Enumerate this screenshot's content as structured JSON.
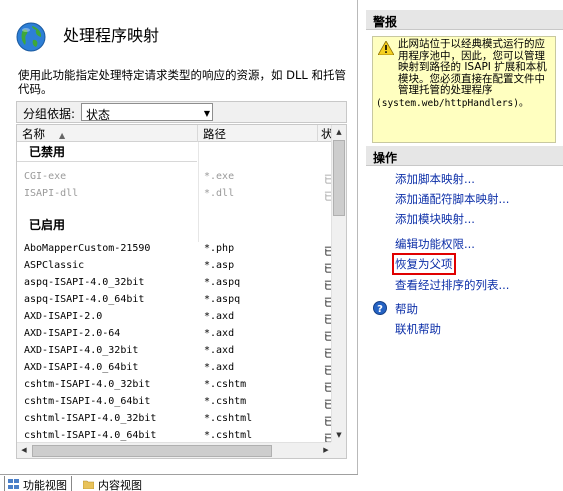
{
  "page": {
    "title": "处理程序映射",
    "description": "使用此功能指定处理特定请求类型的响应的资源，如 DLL 和托管代码。",
    "group_label": "分组依据:",
    "group_value": "状态"
  },
  "list": {
    "columns": [
      "名称",
      "路径",
      "状"
    ],
    "group_disabled": "已禁用",
    "group_enabled": "已启用",
    "disabled_rows": [
      {
        "name": "CGI-exe",
        "path": "*.exe",
        "state": "已"
      },
      {
        "name": "ISAPI-dll",
        "path": "*.dll",
        "state": "已"
      }
    ],
    "enabled_rows": [
      {
        "name": "AboMapperCustom-21590",
        "path": "*.php",
        "state": "已"
      },
      {
        "name": "ASPClassic",
        "path": "*.asp",
        "state": "已"
      },
      {
        "name": "aspq-ISAPI-4.0_32bit",
        "path": "*.aspq",
        "state": "已"
      },
      {
        "name": "aspq-ISAPI-4.0_64bit",
        "path": "*.aspq",
        "state": "已"
      },
      {
        "name": "AXD-ISAPI-2.0",
        "path": "*.axd",
        "state": "已"
      },
      {
        "name": "AXD-ISAPI-2.0-64",
        "path": "*.axd",
        "state": "已"
      },
      {
        "name": "AXD-ISAPI-4.0_32bit",
        "path": "*.axd",
        "state": "已"
      },
      {
        "name": "AXD-ISAPI-4.0_64bit",
        "path": "*.axd",
        "state": "已"
      },
      {
        "name": "cshtm-ISAPI-4.0_32bit",
        "path": "*.cshtm",
        "state": "已"
      },
      {
        "name": "cshtm-ISAPI-4.0_64bit",
        "path": "*.cshtm",
        "state": "已"
      },
      {
        "name": "cshtml-ISAPI-4.0_32bit",
        "path": "*.cshtml",
        "state": "已"
      },
      {
        "name": "cshtml-ISAPI-4.0_64bit",
        "path": "*.cshtml",
        "state": "已"
      }
    ]
  },
  "tabs": [
    "功能视图",
    "内容视图"
  ],
  "alerts": {
    "header": "警报",
    "text": "此网站位于以经典模式运行的应用程序池中，因此，您可以管理映射到路径的 ISAPI 扩展和本机模块。您必须直接在配置文件中管理托管的处理程序",
    "code": "(system.web/httpHandlers)。"
  },
  "actions": {
    "header": "操作",
    "items": [
      "添加脚本映射...",
      "添加通配符脚本映射...",
      "添加模块映射...",
      "编辑功能权限...",
      "恢复为父项",
      "查看经过排序的列表...",
      "帮助",
      "联机帮助"
    ]
  },
  "colors": {
    "link": "#0c2fa8",
    "highlight": "#e00000",
    "alert_bg": "#ffffc0",
    "section_bg": "#e6e6e6"
  },
  "icons": [
    "globe-icon",
    "sort-ascending-icon",
    "dropdown-arrow-icon",
    "warning-icon",
    "help-icon",
    "features-view-icon",
    "content-view-icon"
  ]
}
